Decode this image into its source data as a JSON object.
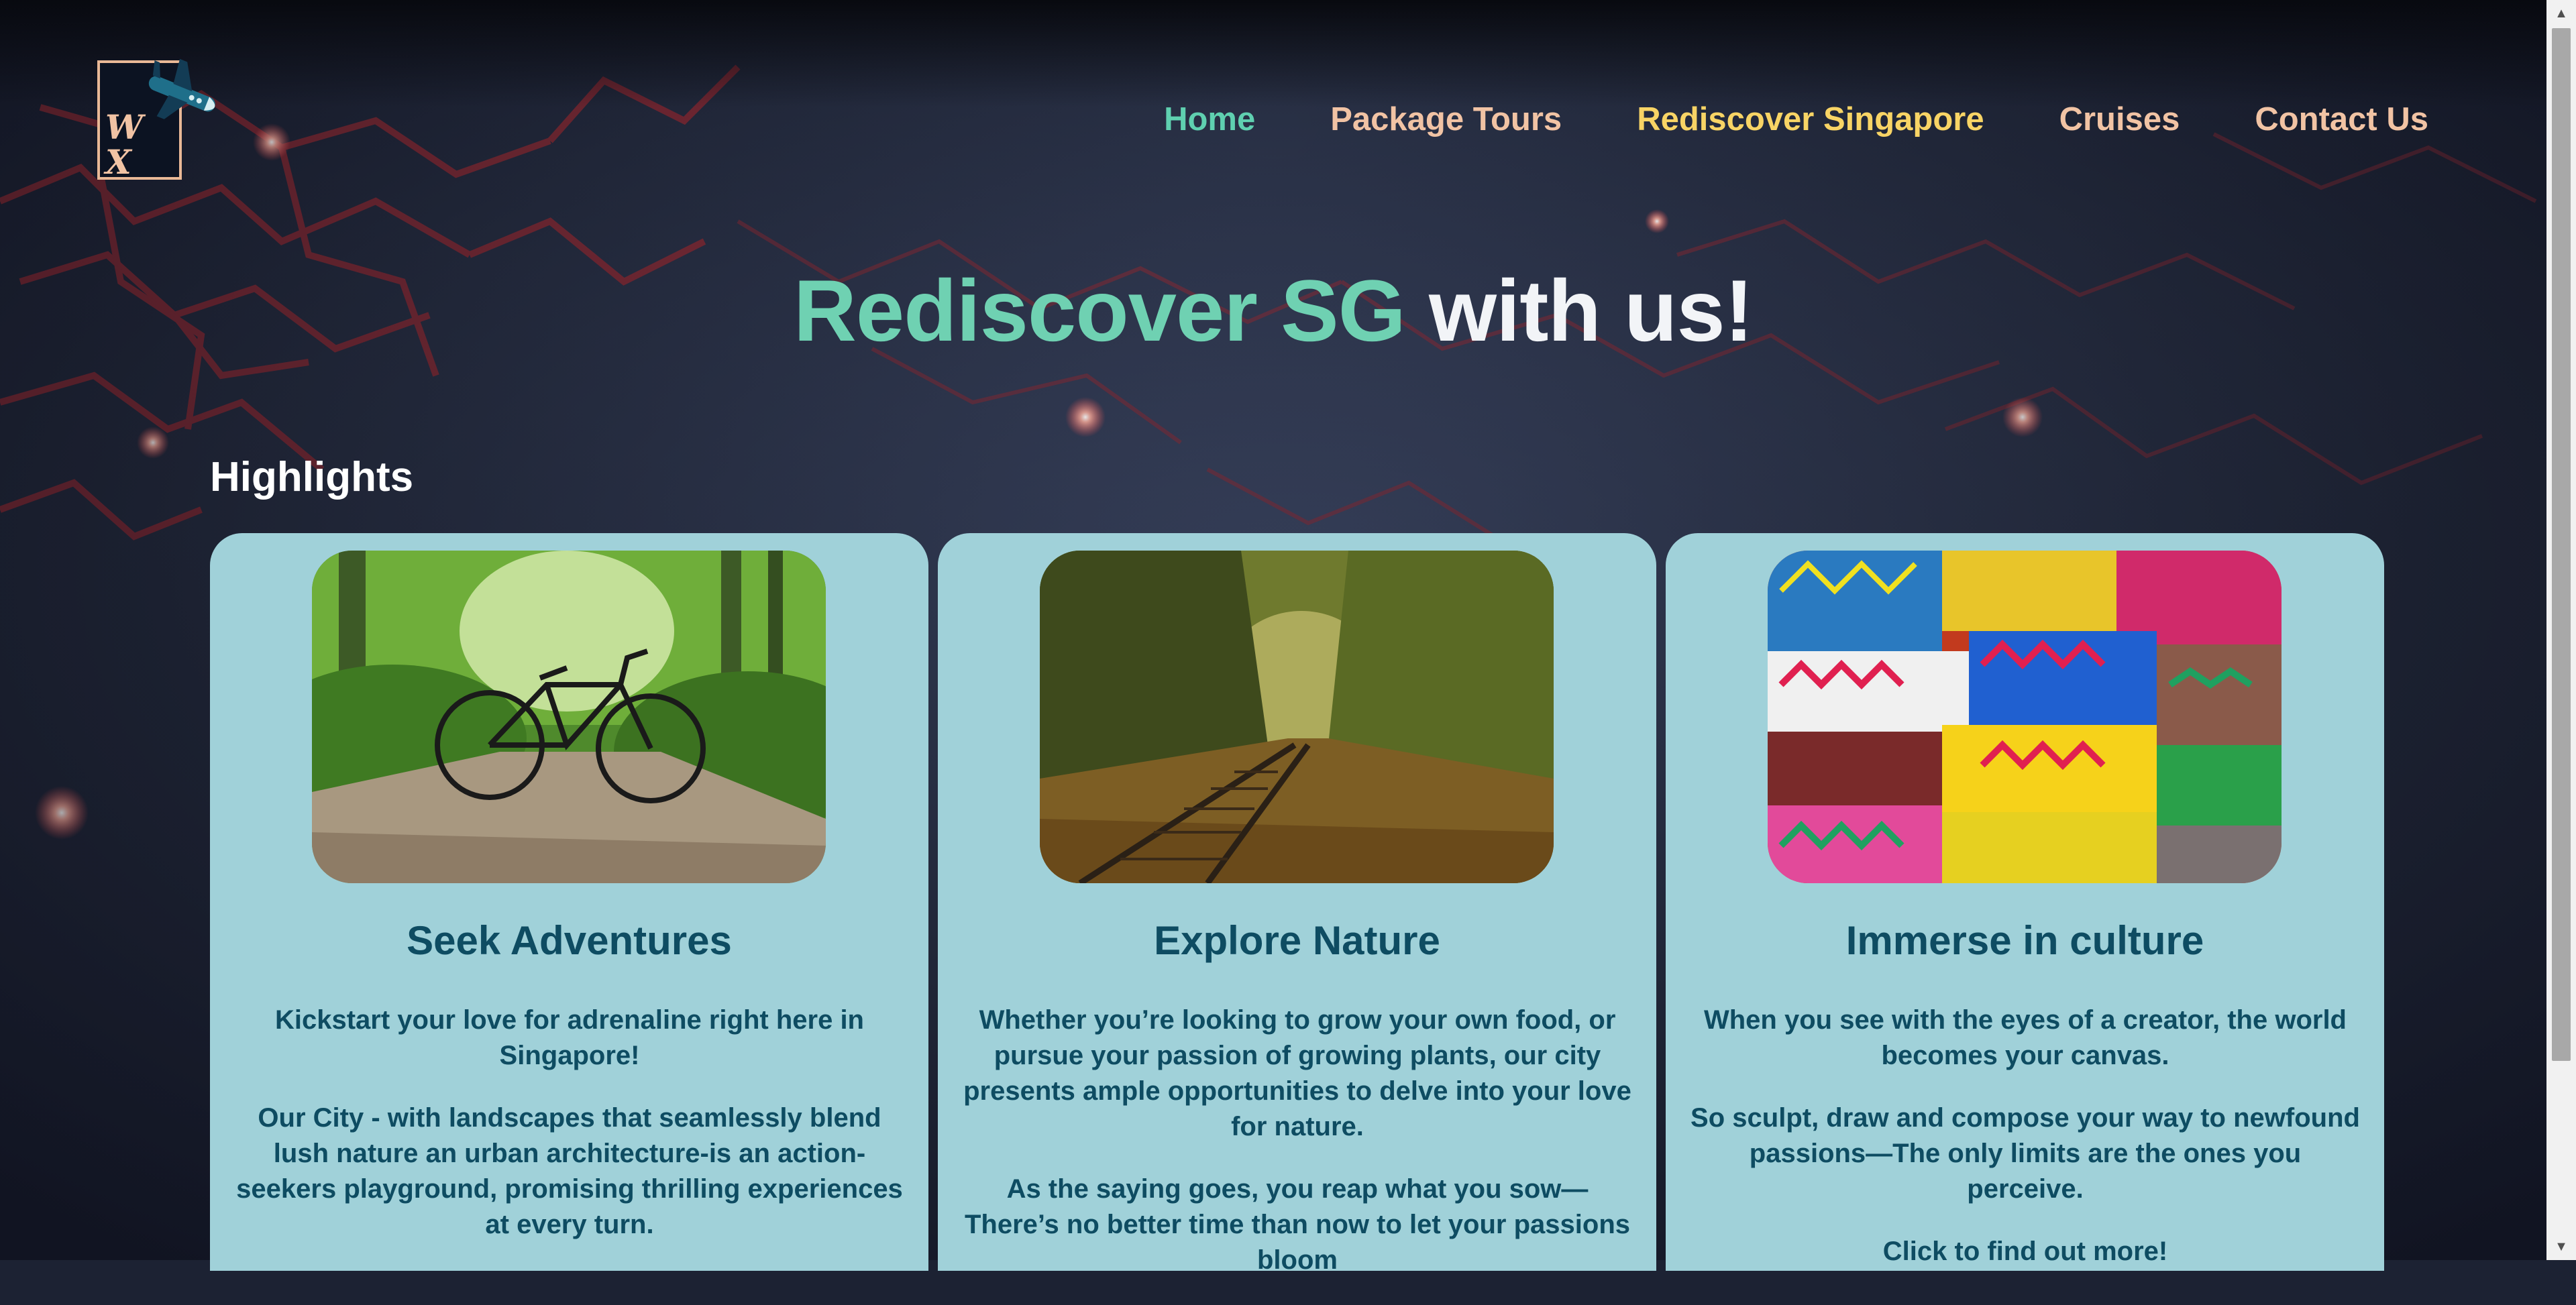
{
  "colors": {
    "accent_green": "#6fd1b2",
    "nav_active": "#5fd0b0",
    "nav_default": "#f1c3a4",
    "nav_highlight": "#f8d465",
    "card_bg": "#a0d1d9",
    "card_text": "#0e4c62"
  },
  "logo": {
    "letters_top": "W",
    "letters_bottom": "X",
    "icon": "airplane-icon"
  },
  "nav": {
    "items": [
      {
        "label": "Home",
        "state": "active"
      },
      {
        "label": "Package Tours",
        "state": "default"
      },
      {
        "label": "Rediscover Singapore",
        "state": "current"
      },
      {
        "label": "Cruises",
        "state": "default"
      },
      {
        "label": "Contact Us",
        "state": "default"
      }
    ]
  },
  "hero": {
    "accent": "Rediscover SG",
    "rest": "with us!"
  },
  "highlights": {
    "heading": "Highlights"
  },
  "cards": [
    {
      "image": "bicycle-on-forest-path",
      "title": "Seek Adventures",
      "paragraphs": [
        "Kickstart your love for adrenaline right here in Singapore!",
        "Our City - with landscapes that seamlessly blend lush nature an urban architecture-is an action-seekers playground, promising thrilling experiences at every turn."
      ]
    },
    {
      "image": "railway-through-autumn-forest",
      "title": "Explore Nature",
      "paragraphs": [
        "Whether you’re looking to grow your own food, or pursue your passion of growing plants, our city presents ample opportunities to delve into your love for nature.",
        "As the saying goes, you reap what you sow—There’s no better time than now to let your passions bloom"
      ]
    },
    {
      "image": "colorful-woven-textiles",
      "title": "Immerse in culture",
      "paragraphs": [
        "When you see with the eyes of a creator, the world becomes your canvas.",
        "So sculpt, draw and compose your way to newfound passions—The only limits are the ones you perceive.",
        "Click to find out more!"
      ]
    }
  ]
}
